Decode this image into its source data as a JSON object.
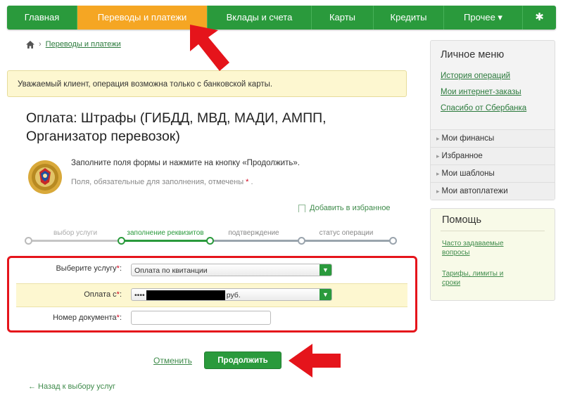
{
  "nav": {
    "items": [
      {
        "label": "Главная"
      },
      {
        "label": "Переводы и платежи"
      },
      {
        "label": "Вклады и счета"
      },
      {
        "label": "Карты"
      },
      {
        "label": "Кредиты"
      },
      {
        "label": "Прочее ▾"
      }
    ],
    "settings_icon": "gear-icon",
    "colors": {
      "bar": "#2a9a3c",
      "active": "#f5a623"
    }
  },
  "breadcrumb": {
    "home_icon": "home-icon",
    "link": "Переводы и платежи"
  },
  "notice": "Уважаемый клиент, операция возможна только с банковской карты.",
  "page_title": "Оплата: Штрафы (ГИБДД, МВД, МАДИ, АМПП, Организатор перевозок)",
  "emblem_icon": "gibdd-emblem-icon",
  "hints": {
    "fill_form": "Заполните поля формы и нажмите на кнопку «Продолжить».",
    "required_note": "Поля, обязательные для заполнения, отмечены",
    "required_mark": "*",
    "required_end": "."
  },
  "favorites": "Добавить в избранное",
  "steps": [
    {
      "label": "выбор услуги",
      "state": "done"
    },
    {
      "label": "заполнение реквизитов",
      "state": "active"
    },
    {
      "label": "подтверждение",
      "state": "pending"
    },
    {
      "label": "статус операции",
      "state": "pending"
    }
  ],
  "form": {
    "service_label": "Выберите услугу",
    "service_value": "Оплата по квитанции",
    "pay_from_label": "Оплата с",
    "pay_from_prefix": "••••",
    "pay_from_suffix": "руб.",
    "doc_label": "Номер документа",
    "doc_value": "",
    "required_mark": "*",
    "colon": ":"
  },
  "buttons": {
    "cancel": "Отменить",
    "continue": "Продолжить"
  },
  "back_link": "← Назад к выбору услуг",
  "sidebar": {
    "title": "Личное меню",
    "links": [
      "История операций",
      "Мои интернет-заказы",
      "Спасибо от Сбербанка"
    ],
    "sections": [
      "Мои финансы",
      "Избранное",
      "Мои шаблоны",
      "Мои автоплатежи"
    ]
  },
  "help": {
    "title": "Помощь",
    "links": [
      "Часто задаваемые вопросы",
      "Тарифы, лимиты и сроки"
    ]
  },
  "annotations": {
    "arrow_color": "#e5141b",
    "highlight_color": "#e5141b"
  }
}
